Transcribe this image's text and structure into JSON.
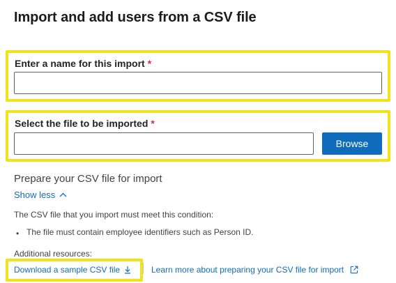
{
  "page": {
    "title": "Import and add users from a CSV file"
  },
  "import_name": {
    "label": "Enter a name for this import",
    "required_marker": "*",
    "value": ""
  },
  "file_select": {
    "label": "Select the file to be imported",
    "required_marker": "*",
    "value": "",
    "browse_label": "Browse"
  },
  "prepare": {
    "heading": "Prepare your CSV file for import",
    "toggle_label": "Show less",
    "condition_text": "The CSV file that you import must meet this condition:",
    "bullets": [
      "The file must contain employee identifiers such as Person ID."
    ],
    "bullet_marker": "•"
  },
  "resources": {
    "heading": "Additional resources:",
    "download_link": "Download a sample CSV file",
    "learn_more_link": "Learn more about preparing your CSV file for import"
  },
  "icons": {
    "toggle": "chevron-up-icon",
    "download": "download-icon",
    "external": "open-external-icon"
  },
  "colors": {
    "accent": "#0f6cbd",
    "highlight": "#f2e21c",
    "required": "#c4314b"
  }
}
